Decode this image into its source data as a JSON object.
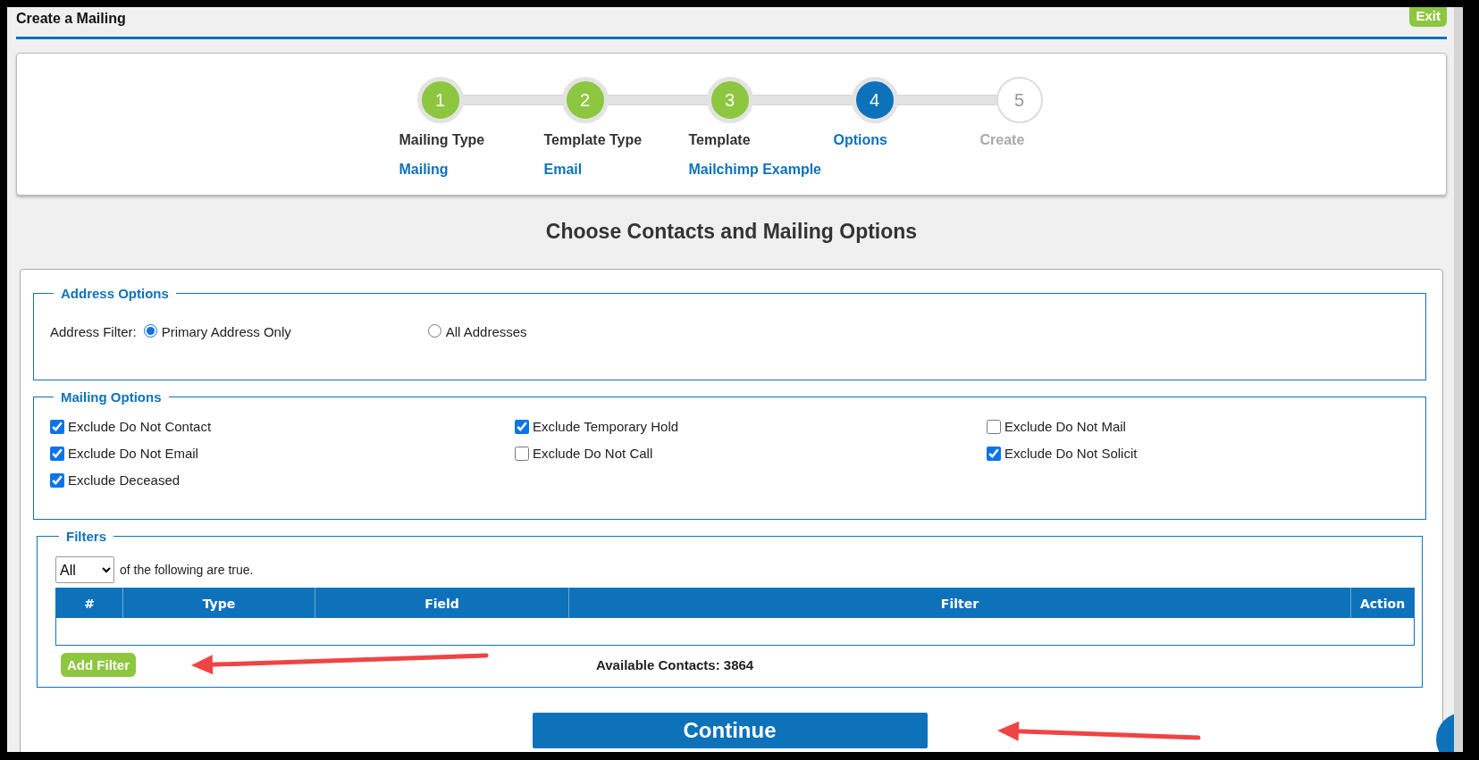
{
  "header": {
    "title": "Create a Mailing",
    "exit_button": "Exit"
  },
  "steps": [
    {
      "number": "1",
      "label": "Mailing Type",
      "value": "Mailing",
      "completed": true,
      "selected": false
    },
    {
      "number": "2",
      "label": "Template Type",
      "value": "Email",
      "completed": true,
      "selected": false
    },
    {
      "number": "3",
      "label": "Template",
      "value": "Mailchimp Example",
      "completed": true,
      "selected": false
    },
    {
      "number": "4",
      "label": "Options",
      "completed": false,
      "selected": true
    },
    {
      "number": "5",
      "label": "Create",
      "completed": false,
      "selected": false
    }
  ],
  "heading": "Choose Contacts and Mailing Options",
  "address_options": {
    "legend": "Address Options",
    "label": "Address Filter:",
    "choices": [
      {
        "label": "Primary Address Only",
        "selected": true
      },
      {
        "label": "All Addresses",
        "selected": false
      }
    ]
  },
  "mailing_options": {
    "legend": "Mailing Options",
    "options": [
      {
        "label": "Exclude Do Not Contact",
        "checked": true
      },
      {
        "label": "Exclude Temporary Hold",
        "checked": true
      },
      {
        "label": "Exclude Do Not Mail",
        "checked": false
      },
      {
        "label": "Exclude Do Not Email",
        "checked": true
      },
      {
        "label": "Exclude Do Not Call",
        "checked": false
      },
      {
        "label": "Exclude Do Not Solicit",
        "checked": true
      },
      {
        "label": "Exclude Deceased",
        "checked": true
      }
    ]
  },
  "filters": {
    "legend": "Filters",
    "match": "All",
    "match_text": "of the following are true.",
    "columns": [
      "#",
      "Type",
      "Field",
      "Filter",
      "Action"
    ],
    "add_button": "Add Filter",
    "available": "Available Contacts: 3864"
  },
  "continue_button": "Continue",
  "annotation_arrows": [
    {
      "kind": "arrow"
    },
    {
      "kind": "arrow"
    }
  ]
}
